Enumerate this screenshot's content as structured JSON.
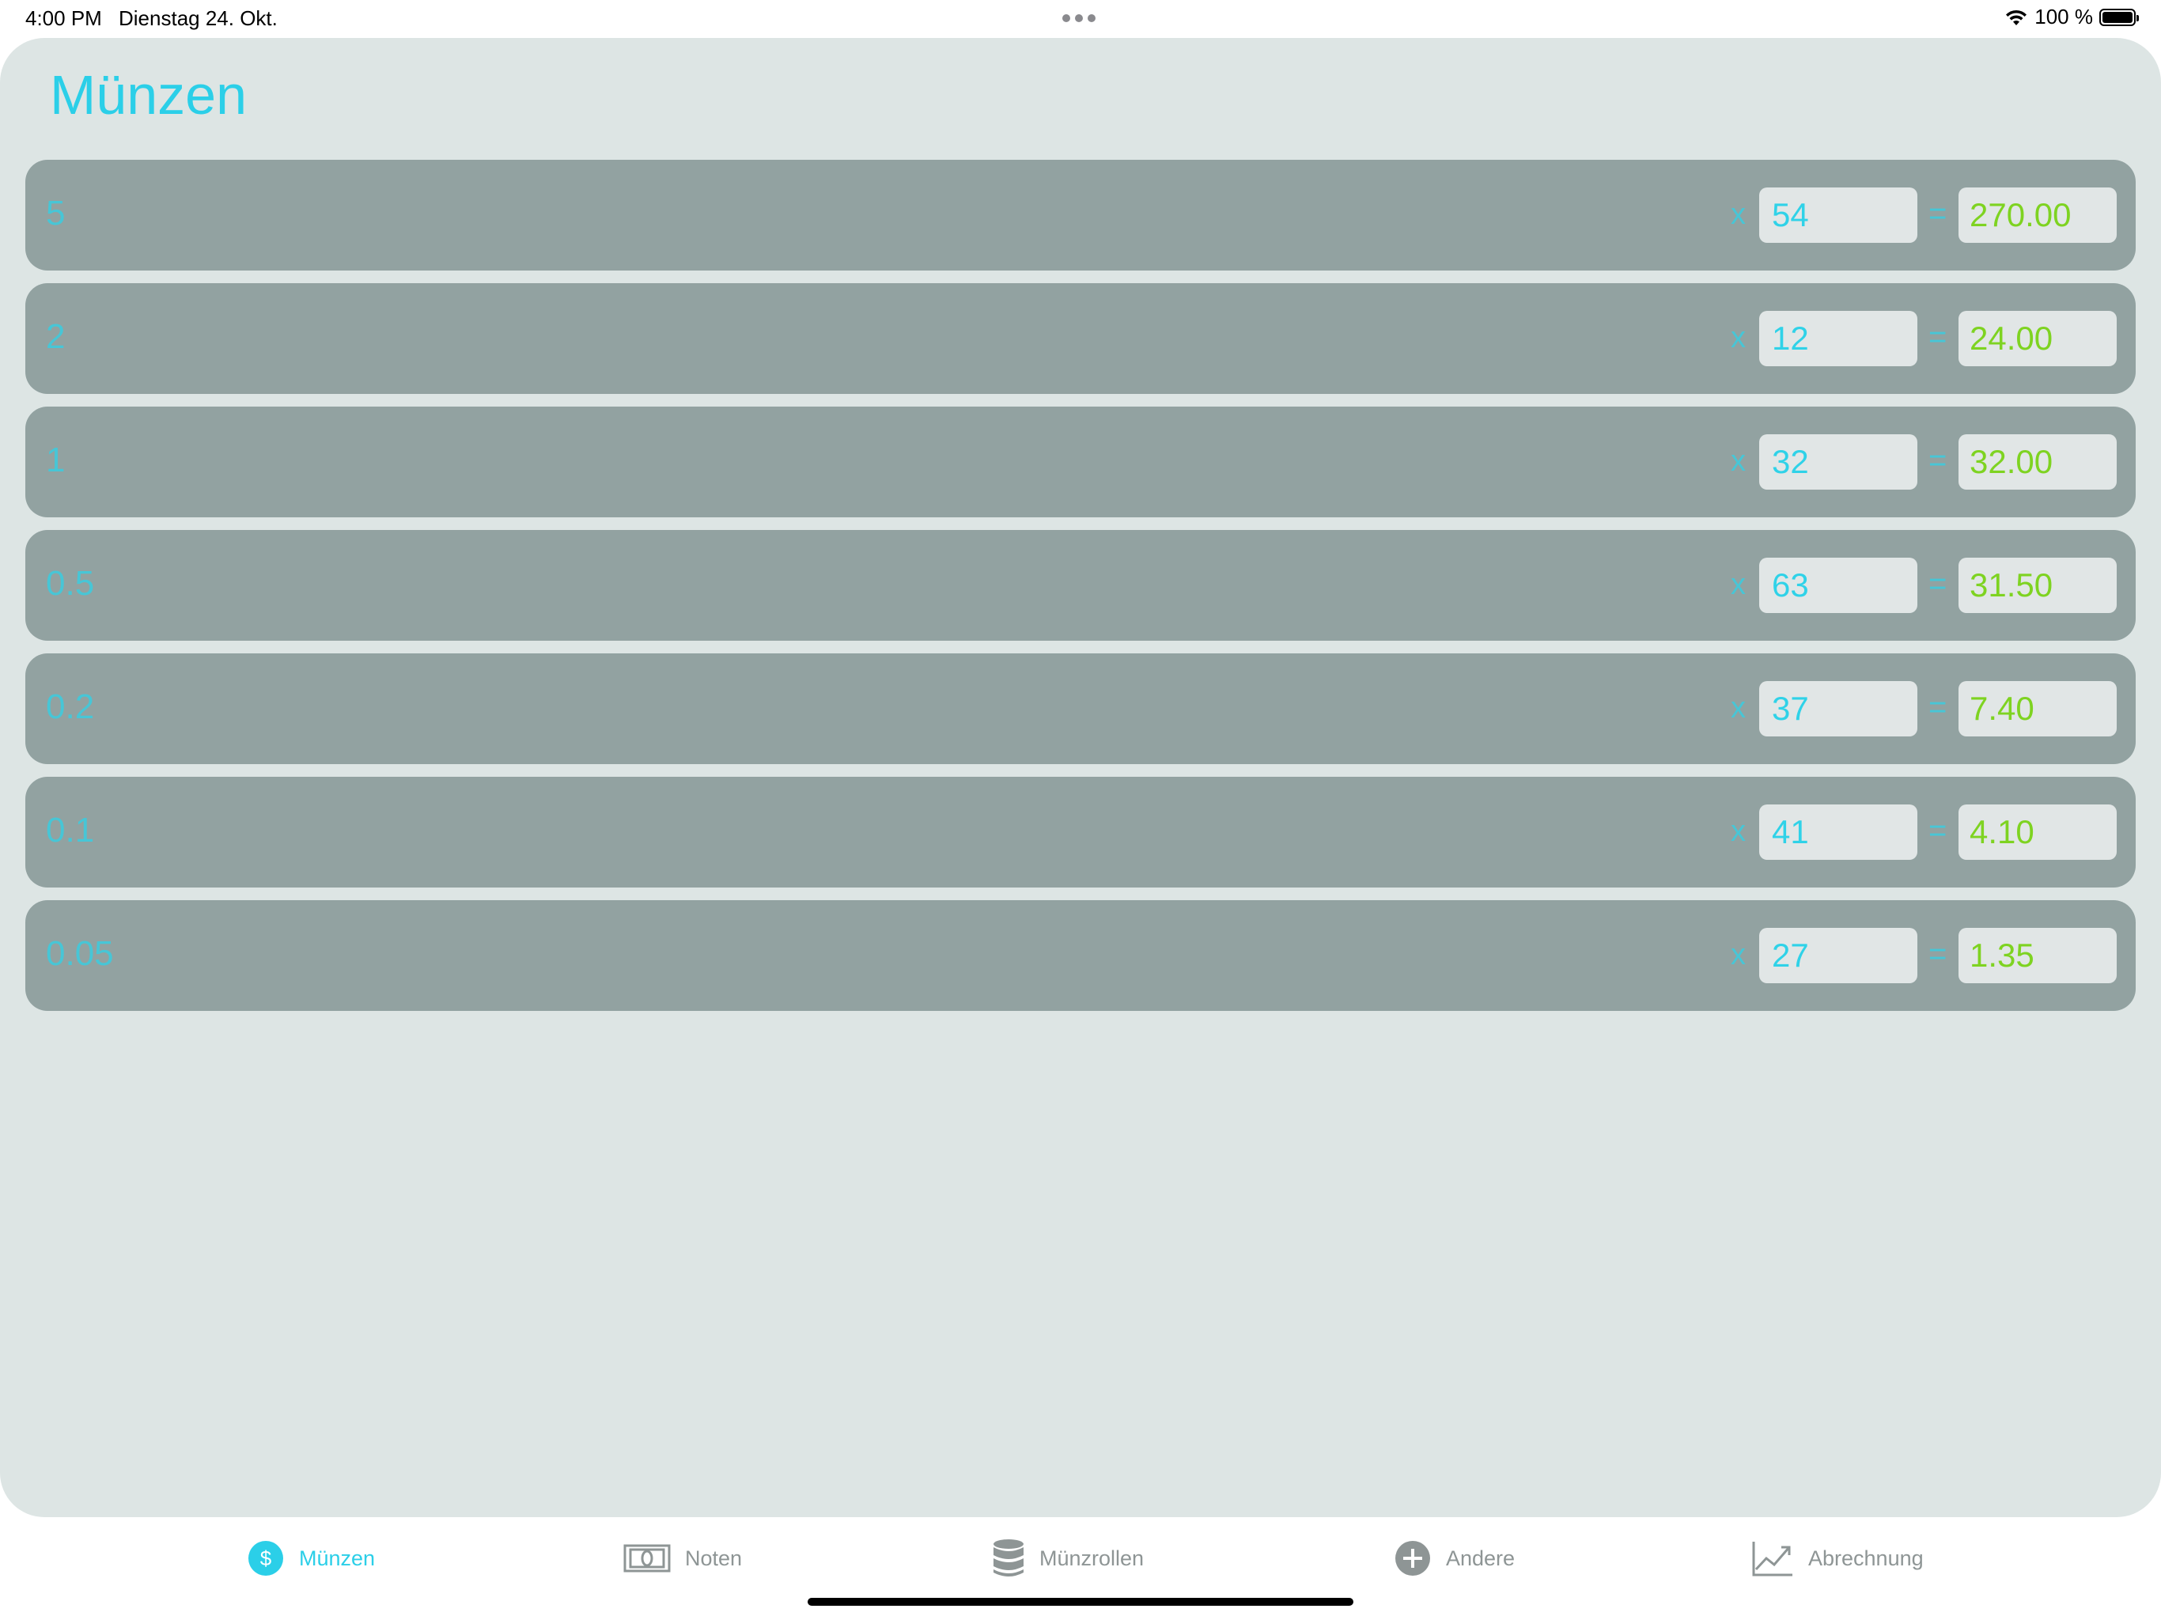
{
  "status_bar": {
    "time": "4:00 PM",
    "date": "Dienstag 24. Okt.",
    "battery_text": "100 %"
  },
  "page": {
    "title": "Münzen"
  },
  "coins": [
    {
      "denomination": "5",
      "multiply_sign": "x",
      "quantity": "54",
      "equals_sign": "=",
      "total": "270.00"
    },
    {
      "denomination": "2",
      "multiply_sign": "x",
      "quantity": "12",
      "equals_sign": "=",
      "total": "24.00"
    },
    {
      "denomination": "1",
      "multiply_sign": "x",
      "quantity": "32",
      "equals_sign": "=",
      "total": "32.00"
    },
    {
      "denomination": "0.5",
      "multiply_sign": "x",
      "quantity": "63",
      "equals_sign": "=",
      "total": "31.50"
    },
    {
      "denomination": "0.2",
      "multiply_sign": "x",
      "quantity": "37",
      "equals_sign": "=",
      "total": "7.40"
    },
    {
      "denomination": "0.1",
      "multiply_sign": "x",
      "quantity": "41",
      "equals_sign": "=",
      "total": "4.10"
    },
    {
      "denomination": "0.05",
      "multiply_sign": "x",
      "quantity": "27",
      "equals_sign": "=",
      "total": "1.35"
    }
  ],
  "tab_bar": {
    "tabs": [
      {
        "label": "Münzen",
        "icon": "dollar-circle-icon",
        "active": true
      },
      {
        "label": "Noten",
        "icon": "banknote-icon",
        "active": false
      },
      {
        "label": "Münzrollen",
        "icon": "coin-stack-icon",
        "active": false
      },
      {
        "label": "Andere",
        "icon": "plus-circle-icon",
        "active": false
      },
      {
        "label": "Abrechnung",
        "icon": "chart-line-icon",
        "active": false
      }
    ]
  },
  "colors": {
    "accent": "#2bcfe8",
    "total_green": "#7ed321",
    "row_background": "#92a2a1",
    "panel_background": "#dde5e4",
    "inactive_tab": "#8e9595"
  }
}
